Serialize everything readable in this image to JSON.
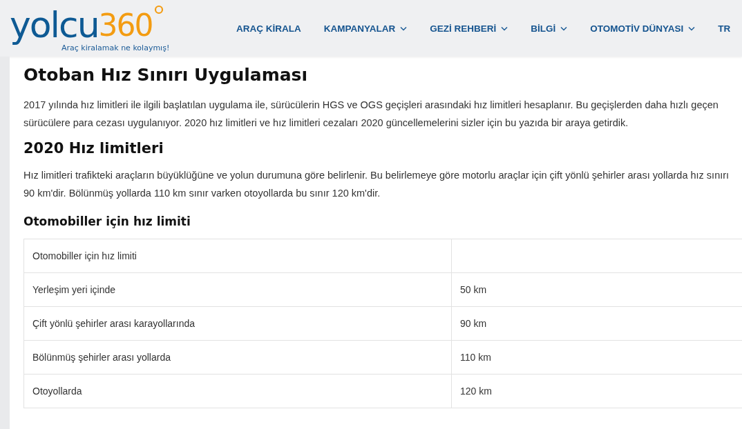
{
  "logo": {
    "word": "yolcu",
    "number": "360",
    "tagline": "Araç kiralamak ne kolaymış!"
  },
  "nav": [
    {
      "label": "ARAÇ KİRALA",
      "has_dropdown": false
    },
    {
      "label": "KAMPANYALAR",
      "has_dropdown": true
    },
    {
      "label": "GEZİ REHBERİ",
      "has_dropdown": true
    },
    {
      "label": "BİLGİ",
      "has_dropdown": true
    },
    {
      "label": "OTOMOTİV DÜNYASI",
      "has_dropdown": true
    },
    {
      "label": "TR",
      "has_dropdown": false
    }
  ],
  "article": {
    "title": "Otoban Hız Sınırı Uygulaması",
    "intro": "2017 yılında hız limitleri ile ilgili başlatılan uygulama ile, sürücülerin HGS ve OGS geçişleri arasındaki hız limitleri hesaplanır. Bu geçişlerden daha hızlı geçen sürücülere para cezası uygulanıyor. 2020 hız limitleri ve hız limitleri cezaları 2020 güncellemelerini sizler için bu yazıda bir araya getirdik.",
    "section_title": "2020 Hız limitleri",
    "section_text": "Hız limitleri trafikteki araçların büyüklüğüne ve yolun durumuna göre belirlenir. Bu belirlemeye göre motorlu araçlar için çift yönlü şehirler arası yollarda hız sınırı 90 km'dir. Bölünmüş yollarda 110 km sınır varken otoyollarda bu sınır 120 km'dir.",
    "subsection_title": "Otomobiller için hız limiti",
    "table": {
      "rows": [
        [
          "Otomobiller için hız limiti",
          ""
        ],
        [
          "Yerleşim yeri içinde",
          "50 km"
        ],
        [
          "Çift yönlü şehirler arası karayollarında",
          "90 km"
        ],
        [
          "Bölünmüş şehirler arası yollarda",
          "110 km"
        ],
        [
          "Otoyollarda",
          "120 km"
        ]
      ]
    }
  }
}
